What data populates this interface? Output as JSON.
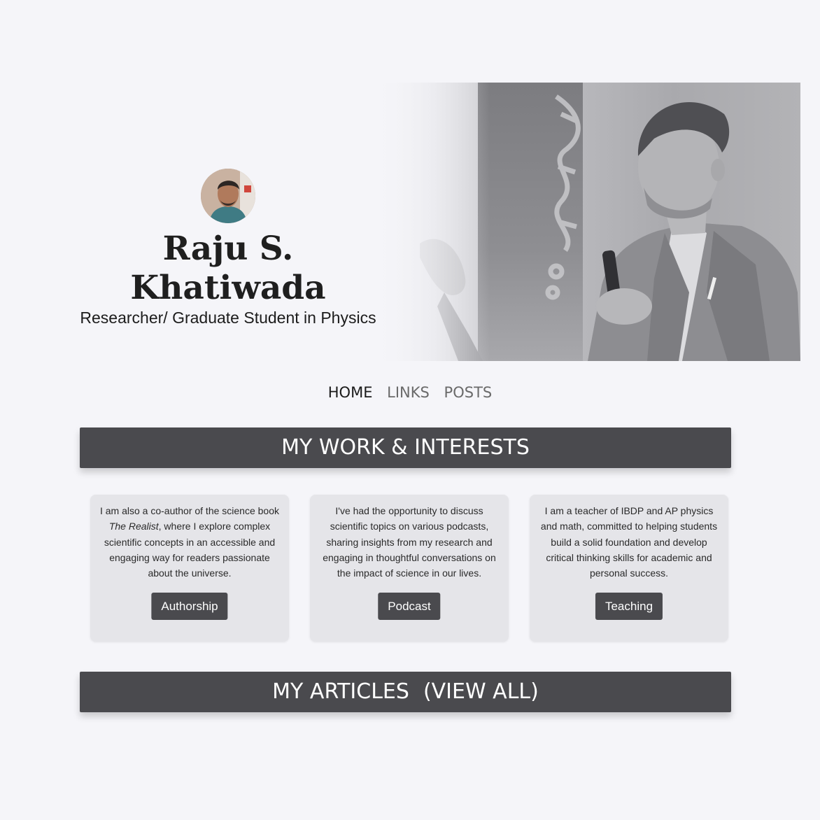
{
  "profile": {
    "name_line1": "Raju S.",
    "name_line2": "Khatiwada",
    "subtitle": "Researcher/ Graduate Student in Physics"
  },
  "nav": {
    "items": [
      {
        "label": "HOME",
        "active": true
      },
      {
        "label": "LINKS",
        "active": false
      },
      {
        "label": "POSTS",
        "active": false
      }
    ]
  },
  "sections": {
    "work_title": "MY WORK & INTERESTS",
    "articles_title": "MY ARTICLES",
    "articles_link": "(VIEW ALL)"
  },
  "cards": [
    {
      "text_before": "I am also a co-author of the science book ",
      "text_em": "The Realist",
      "text_after": ", where I explore complex scientific concepts in an accessible and engaging way for readers passionate about the universe.",
      "button": "Authorship"
    },
    {
      "text": "I've had the opportunity to discuss scientific topics on various podcasts, sharing insights from my research and engaging in thoughtful conversations on the impact of science in our lives.",
      "button": "Podcast"
    },
    {
      "text": "I am a teacher of IBDP and AP physics and math, committed to helping students build a solid foundation and develop critical thinking skills for academic and personal success.",
      "button": "Teaching"
    }
  ],
  "colors": {
    "page_background": "#f5f5f9",
    "bar_background": "#4a4a4e",
    "card_background": "#e5e5e9",
    "button_background": "#4a4a4e",
    "nav_active": "#1b1b1b",
    "nav_inactive": "#6a6a6a"
  }
}
